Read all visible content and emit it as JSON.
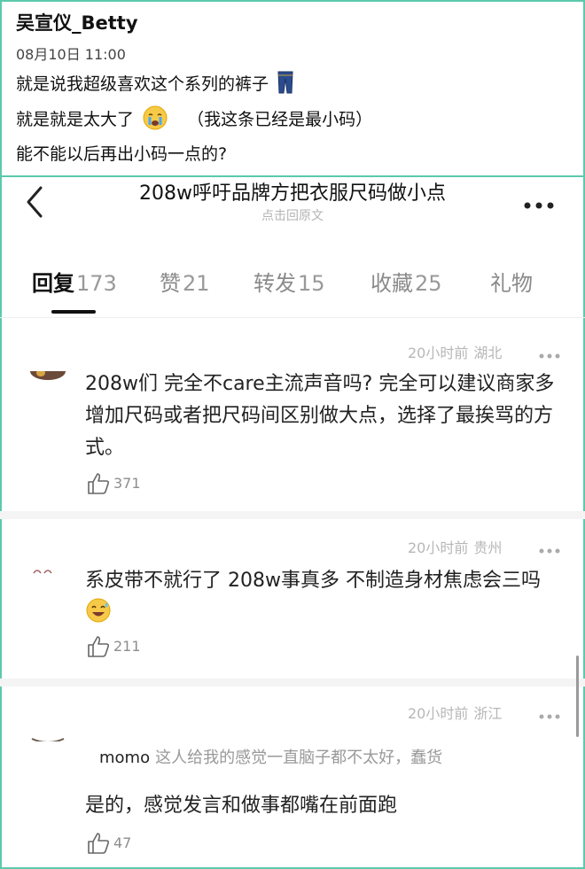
{
  "post": {
    "username": "吴宣仪_Betty",
    "time": "08月10日 11:00",
    "lines": [
      "就是说我超级喜欢这个系列的裤子",
      "就是就是太大了",
      "（我这条已经是最小码）",
      "能不能以后再出小码一点的?"
    ],
    "emoji_icons": [
      "jeans-icon",
      "crying-face-icon"
    ]
  },
  "header": {
    "title": "208w呼吁品牌方把衣服尺码做小点",
    "subtitle": "点击回原文"
  },
  "tabs": [
    {
      "label": "回复",
      "count": "173",
      "active": true
    },
    {
      "label": "赞",
      "count": "21"
    },
    {
      "label": "转发",
      "count": "15"
    },
    {
      "label": "收藏",
      "count": "25"
    },
    {
      "label": "礼物",
      "count": ""
    }
  ],
  "comments": [
    {
      "time": "20小时前",
      "location": "湖北",
      "text": "208w们 完全不care主流声音吗? 完全可以建议商家多增加尺码或者把尺码间区别做大点，选择了最挨骂的方式。",
      "likes": "371"
    },
    {
      "time": "20小时前",
      "location": "贵州",
      "text": "系皮带不就行了 208w事真多 不制造身材焦虑会三吗",
      "emoji": "sweat-smile-icon",
      "likes": "211"
    },
    {
      "time": "20小时前",
      "location": "浙江",
      "reply_to": {
        "name": "momo",
        "text": "这人给我的感觉一直脑子都不太好，蠢货"
      },
      "text": "是的，感觉发言和做事都嘴在前面跑",
      "likes": "47"
    }
  ],
  "colors": {
    "frame": "#5cc9ad",
    "muted": "#b7b7b7",
    "text": "#222222"
  }
}
